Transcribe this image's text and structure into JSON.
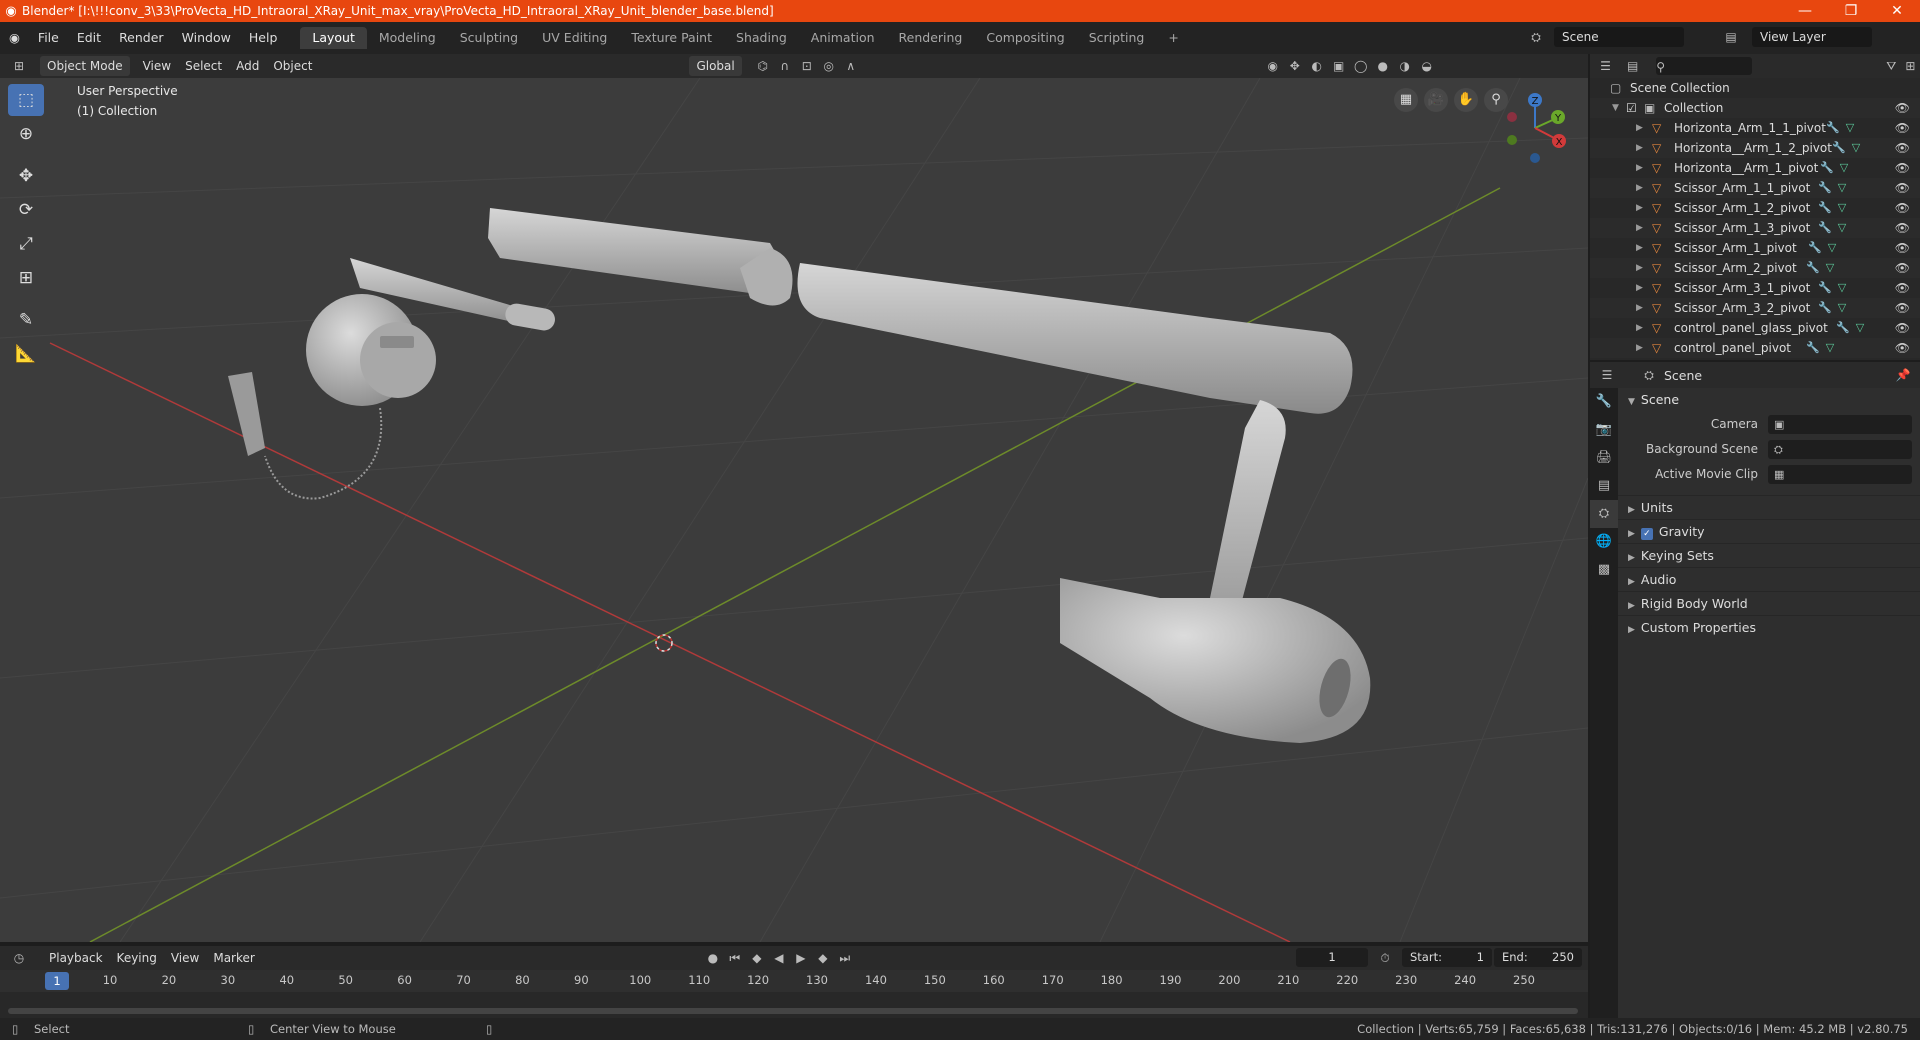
{
  "window": {
    "title": "Blender* [I:\\!!!conv_3\\33\\ProVecta_HD_Intraoral_XRay_Unit_max_vray\\ProVecta_HD_Intraoral_XRay_Unit_blender_base.blend]",
    "minimize": "—",
    "maximize": "❐",
    "close": "✕"
  },
  "menu": [
    "File",
    "Edit",
    "Render",
    "Window",
    "Help"
  ],
  "workspaces": [
    "Layout",
    "Modeling",
    "Sculpting",
    "UV Editing",
    "Texture Paint",
    "Shading",
    "Animation",
    "Rendering",
    "Compositing",
    "Scripting"
  ],
  "active_workspace": "Layout",
  "add_workspace": "+",
  "scene_name": "Scene",
  "view_layer": "View Layer",
  "viewport_header": {
    "mode": "Object Mode",
    "menus": [
      "View",
      "Select",
      "Add",
      "Object"
    ],
    "transform_orientation": "Global"
  },
  "viewport": {
    "perspective_label": "User Perspective",
    "collection_label": "(1) Collection",
    "gizmo_axes": [
      "Z",
      "Y",
      "X"
    ]
  },
  "outliner": {
    "root": "Scene Collection",
    "collection": "Collection",
    "items": [
      "Horizonta_Arm_1_1_pivot",
      "Horizonta__Arm_1_2_pivot",
      "Horizonta__Arm_1_pivot",
      "Scissor_Arm_1_1_pivot",
      "Scissor_Arm_1_2_pivot",
      "Scissor_Arm_1_3_pivot",
      "Scissor_Arm_1_pivot",
      "Scissor_Arm_2_pivot",
      "Scissor_Arm_3_1_pivot",
      "Scissor_Arm_3_2_pivot",
      "control_panel_glass_pivot",
      "control_panel_pivot"
    ]
  },
  "properties": {
    "header": "Scene",
    "panel": "Scene",
    "camera_label": "Camera",
    "background_scene_label": "Background Scene",
    "active_movie_clip_label": "Active Movie Clip",
    "subpanels": [
      "Units",
      "Gravity",
      "Keying Sets",
      "Audio",
      "Rigid Body World",
      "Custom Properties"
    ]
  },
  "timeline": {
    "menus": [
      "Playback",
      "Keying",
      "View",
      "Marker"
    ],
    "current_frame": "1",
    "start_label": "Start:",
    "start": "1",
    "end_label": "End:",
    "end": "250",
    "ticks": [
      "1",
      "10",
      "20",
      "30",
      "40",
      "50",
      "60",
      "70",
      "80",
      "90",
      "100",
      "110",
      "120",
      "130",
      "140",
      "150",
      "160",
      "170",
      "180",
      "190",
      "200",
      "210",
      "220",
      "230",
      "240",
      "250"
    ]
  },
  "statusbar": {
    "select": "Select",
    "center_view": "Center View to Mouse",
    "stats": "Collection | Verts:65,759 | Faces:65,638 | Tris:131,276 | Objects:0/16 | Mem: 45.2 MB | v2.80.75"
  }
}
